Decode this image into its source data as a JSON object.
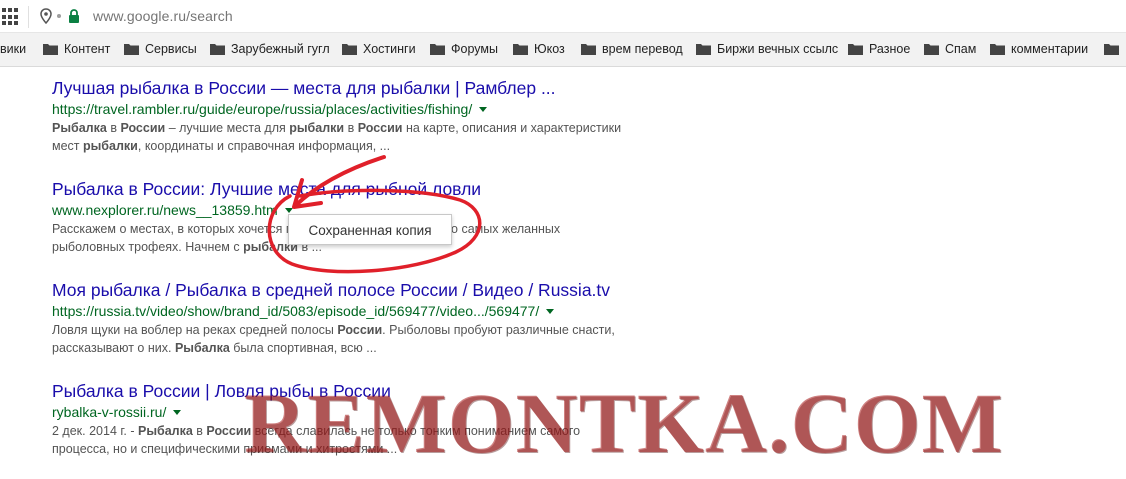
{
  "address_bar": {
    "url": "www.google.ru/search",
    "icons": [
      "apps-grid-icon",
      "location-pin-icon",
      "lock-icon"
    ]
  },
  "bookmarks": [
    {
      "label": "вики"
    },
    {
      "label": "Контент"
    },
    {
      "label": "Сервисы"
    },
    {
      "label": "Зарубежный гугл"
    },
    {
      "label": "Хостинги"
    },
    {
      "label": "Форумы"
    },
    {
      "label": "Юкоз"
    },
    {
      "label": "врем перевод"
    },
    {
      "label": "Биржи вечных ссылс"
    },
    {
      "label": "Разное"
    },
    {
      "label": "Спам"
    },
    {
      "label": "комментарии"
    }
  ],
  "results": [
    {
      "title": "Лучшая рыбалка в России — места для рыбалки | Рамблер ...",
      "url": "https://travel.rambler.ru/guide/europe/russia/places/activities/fishing/",
      "snippet_lines": [
        [
          {
            "t": "Рыбалка",
            "b": true
          },
          {
            "t": " в ",
            "b": false
          },
          {
            "t": "России",
            "b": true
          },
          {
            "t": " – лучшие места для ",
            "b": false
          },
          {
            "t": "рыбалки",
            "b": true
          },
          {
            "t": " в ",
            "b": false
          },
          {
            "t": "России",
            "b": true
          },
          {
            "t": " на карте, описания и характеристики",
            "b": false
          }
        ],
        [
          {
            "t": "мест ",
            "b": false
          },
          {
            "t": "рыбалки",
            "b": true
          },
          {
            "t": ", координаты и справочная информация, ...",
            "b": false
          }
        ]
      ]
    },
    {
      "title": "Рыбалка в России: Лучшие места для рыбной ловли",
      "url": "www.nexplorer.ru/news__13859.htm",
      "snippet_lines": [
        [
          {
            "t": "Расскажем о местах, в которых хочется побывать каждому рыбак, и о самых желанных",
            "b": false
          }
        ],
        [
          {
            "t": "рыболовных трофеях. Начнем с ",
            "b": false
          },
          {
            "t": "рыбалки",
            "b": true
          },
          {
            "t": " в ...",
            "b": false
          }
        ]
      ]
    },
    {
      "title": "Моя рыбалка / Рыбалка в средней полосе России / Видео / Russia.tv",
      "url": "https://russia.tv/video/show/brand_id/5083/episode_id/569477/video.../569477/",
      "snippet_lines": [
        [
          {
            "t": "Ловля щуки на воблер на реках средней полосы ",
            "b": false
          },
          {
            "t": "России",
            "b": true
          },
          {
            "t": ". Рыболовы пробуют различные снасти,",
            "b": false
          }
        ],
        [
          {
            "t": "рассказывают о них. ",
            "b": false
          },
          {
            "t": "Рыбалка",
            "b": true
          },
          {
            "t": " была спортивная, всю ...",
            "b": false
          }
        ]
      ]
    },
    {
      "title": "Рыбалка в России | Ловля рыбы в России",
      "url": "rybalka-v-rossii.ru/",
      "snippet_lines": [
        [
          {
            "t": "2 дек. 2014 г. - ",
            "b": false
          },
          {
            "t": "Рыбалка",
            "b": true
          },
          {
            "t": " в ",
            "b": false
          },
          {
            "t": "России",
            "b": true
          },
          {
            "t": " всегда славилась не только тонким пониманием самого",
            "b": false
          }
        ],
        [
          {
            "t": "процесса, но и специфическими приемами и хитростями ...",
            "b": false
          }
        ]
      ]
    }
  ],
  "popup": {
    "label": "Сохраненная копия"
  },
  "watermark": {
    "text": "REMONTKA.COM"
  },
  "colors": {
    "link": "#1a0dab",
    "url": "#006621",
    "snippet": "#545454",
    "annotation": "#e0202a",
    "lock": "#0b8043"
  }
}
